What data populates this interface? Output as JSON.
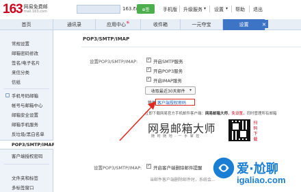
{
  "header": {
    "logo_number": "163",
    "logo_line1": "网易免费邮",
    "logo_line2": "mail.163.com",
    "domain": "163.com",
    "green_button": "⊕签",
    "nav": [
      "手机版",
      "升级服务",
      "设置",
      "帮助",
      "退出"
    ]
  },
  "tabs": [
    {
      "label": "首页"
    },
    {
      "label": "通讯录"
    },
    {
      "label": "应用中心",
      "badge": "新"
    },
    {
      "label": "收件箱"
    },
    {
      "label": "一元夺宝"
    },
    {
      "label": "设置"
    }
  ],
  "close_symbol": "×",
  "sidebar": {
    "items": [
      "常规设置",
      "邮箱密码修改",
      "签名/电子名片",
      "来信分类",
      "信纸",
      "手机号码邮箱",
      "帐号与邮箱中心",
      "邮箱安全设置",
      "邮箱手机服务",
      "反垃圾/黑白名单",
      "POP3/SMTP/IMAP",
      "客户端授权密码",
      "文件夹和标签",
      "多标签窗口"
    ],
    "active_index": 10
  },
  "main": {
    "title": "POP3/SMTP/IMAP",
    "row_label": "设置POP3/SMTP/IMAP:",
    "options": [
      {
        "label": "开启SMTP服务",
        "checked": true
      },
      {
        "label": "开启POP3服务",
        "checked": true
      },
      {
        "label": "开启IMAP服务",
        "checked": true
      }
    ],
    "select_value": "收取最近30天邮件",
    "manage_prefix": "管理",
    "auth_link": "客户端授权密码",
    "notice_prefix": "立即下载网易官方手机邮件客户端：",
    "notice_bold": "网易邮箱大师",
    "notice_free": "，免设置，",
    "notice_suffix": "同时管理所有邮箱",
    "promo_title": "网易邮箱大师",
    "promo_sub": "随 时 随 地 · 一 手 掌 控",
    "scan_text": "扫码下载",
    "bottom_label": "设置POP3/SMTP/IMAP:",
    "bottom_option": "开启客户端删除邮件提醒",
    "bottom_line2": "当邮件客户端删除邮件时，系统会..."
  },
  "watermark": {
    "text": "爱·尬聊",
    "url": "igaliao.com"
  },
  "colors": {
    "brand_red": "#d0021b",
    "tab_active": "#3e74c6",
    "highlight_box": "#e0281c",
    "link": "#1c5cc4",
    "watermark": "#1a7fd4"
  }
}
